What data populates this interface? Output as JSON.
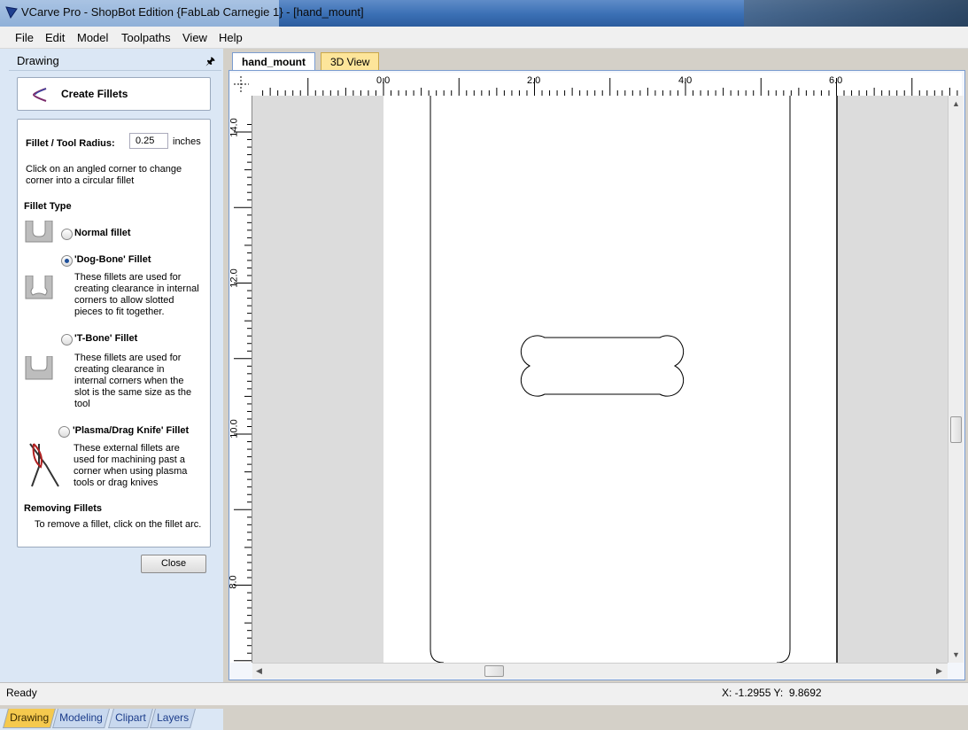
{
  "window": {
    "title": "VCarve Pro - ShopBot Edition {FabLab Carnegie 1} - [hand_mount]"
  },
  "menu": [
    "File",
    "Edit",
    "Model",
    "Toolpaths",
    "View",
    "Help"
  ],
  "left_panel": {
    "header": "Drawing",
    "pin_icon": "pin-icon",
    "tool_title": "Create Fillets",
    "radius_label": "Fillet / Tool Radius:",
    "radius_value": "0.25",
    "radius_unit": "inches",
    "instruction": [
      "Click on an angled corner to change",
      "corner into a circular fillet"
    ],
    "fillet_type_label": "Fillet Type",
    "options": [
      {
        "label": "Normal fillet",
        "selected": false,
        "desc": []
      },
      {
        "label": "'Dog-Bone' Fillet",
        "selected": true,
        "desc": [
          "These fillets are used for",
          "creating clearance in internal",
          "corners to allow slotted",
          "pieces to fit together."
        ]
      },
      {
        "label": "'T-Bone' Fillet",
        "selected": false,
        "desc": [
          "These fillets are used for",
          "creating clearance in",
          "internal corners when the",
          "slot is the same size as the",
          "tool"
        ]
      },
      {
        "label": "'Plasma/Drag Knife' Fillet",
        "selected": false,
        "desc": [
          "These external fillets are",
          "used for machining past a",
          "corner when using plasma",
          "tools or drag knives"
        ]
      }
    ],
    "removing_label": "Removing Fillets",
    "removing_text": "To remove a fillet, click on the fillet arc.",
    "close_label": "Close",
    "bottom_tabs": [
      "Drawing",
      "Modeling",
      "Clipart",
      "Layers"
    ],
    "active_bottom_tab": "Drawing"
  },
  "document": {
    "tabs": [
      "hand_mount",
      "3D View"
    ],
    "active_tab": "hand_mount",
    "hruler_labels": [
      "0.0",
      "2.0",
      "4.0",
      "6.0"
    ],
    "vruler_labels": [
      "14.0",
      "12.0",
      "10.0",
      "8.0"
    ]
  },
  "status": {
    "left": "Ready",
    "coords": "X: -1.2955 Y:  9.8692"
  }
}
